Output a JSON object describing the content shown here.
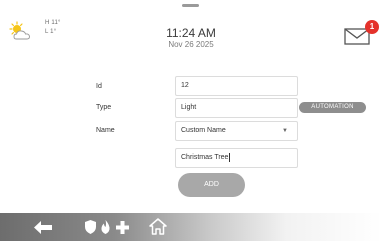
{
  "weather": {
    "icon": "partly-cloudy-icon",
    "high": "H 11°",
    "low": "L 1°"
  },
  "clock": {
    "time": "11:24 AM",
    "date": "Nov 26 2025"
  },
  "notifications": {
    "icon": "mail-icon",
    "count": "1"
  },
  "form": {
    "id_label": "Id",
    "id_value": "12",
    "type_label": "Type",
    "type_value": "Light",
    "automation_label": "AUTOMATION",
    "name_label": "Name",
    "name_select_value": "Custom Name",
    "custom_name_value": "Christmas Tree",
    "add_label": "ADD"
  },
  "nav": {
    "items": [
      "back-arrow-icon",
      "shield-icon",
      "flame-icon",
      "plus-icon",
      "home-icon"
    ]
  },
  "colors": {
    "badge": "#e4322b",
    "sun": "#f5c518",
    "button": "#a8a8a8"
  }
}
